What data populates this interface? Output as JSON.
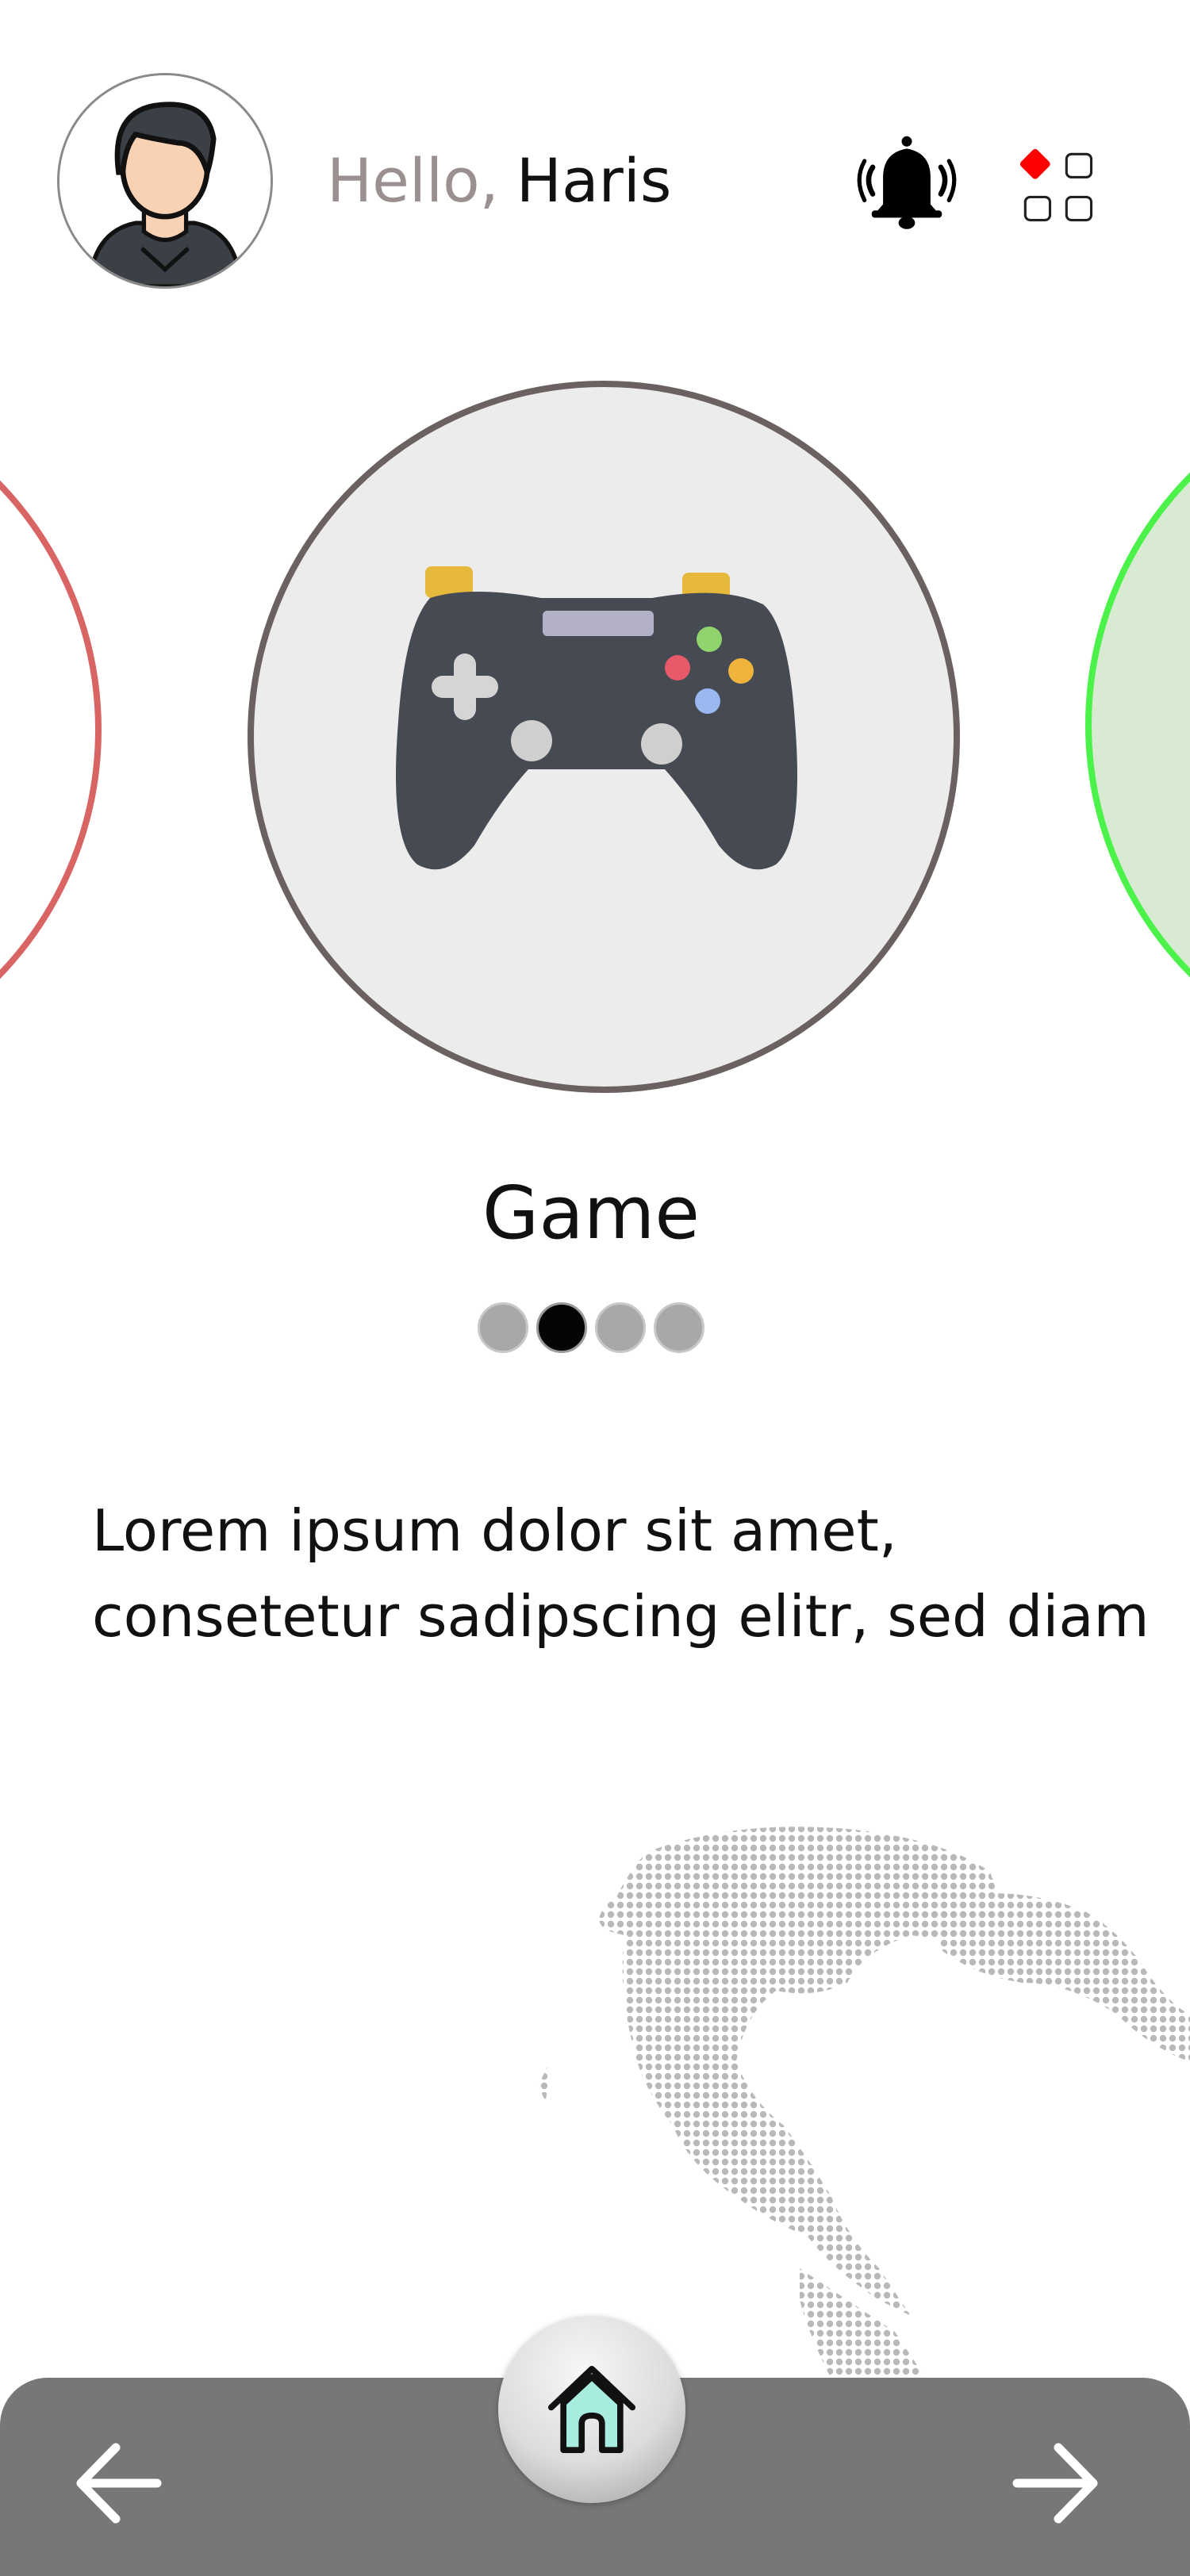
{
  "header": {
    "greeting": "Hello,",
    "user_name": "Haris",
    "avatar_icon": "user-avatar-icon",
    "notification_icon": "bell-ringing-icon",
    "apps_icon": "app-grid-icon"
  },
  "carousel": {
    "current_title": "Game",
    "current_icon": "gamepad-icon",
    "page_count": 4,
    "active_index": 1,
    "description": "Lorem ipsum dolor sit amet, consetetur sadipscing elitr, sed diam"
  },
  "bottom_nav": {
    "back_icon": "arrow-left-icon",
    "home_icon": "home-icon",
    "next_icon": "arrow-right-icon"
  },
  "colors": {
    "left_card_border": "#d86464",
    "right_card_border": "#4af24a",
    "right_card_fill": "#d9ead3",
    "main_card_border": "#6b6161",
    "main_card_fill": "#ececec",
    "bottom_bar": "#777777",
    "apps_accent": "#ff0000"
  }
}
